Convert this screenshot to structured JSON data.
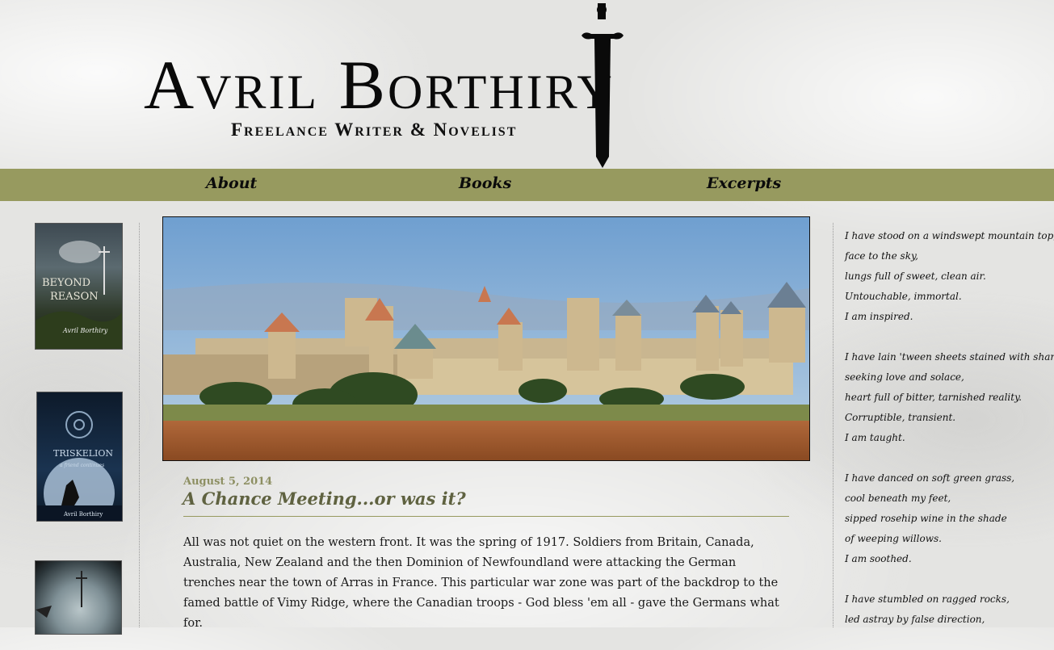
{
  "header": {
    "author_name": "Avril Borthiry",
    "tagline": "Freelance Writer & Novelist"
  },
  "nav": {
    "items": [
      "About",
      "Books",
      "Excerpts"
    ],
    "color": "#979a5f"
  },
  "covers": [
    {
      "title_line1": "BEYOND",
      "title_line2": "REASON",
      "author": "Avril Borthiry"
    },
    {
      "title": "TRISKELION",
      "subtitle": "a friend continues",
      "author": "Avril Borthiry"
    },
    {}
  ],
  "post": {
    "date": "August 5, 2014",
    "title": "A Chance Meeting...or was it?",
    "body": "All was not quiet on the western front. It was the spring of 1917. Soldiers from Britain, Canada, Australia, New Zealand and the then Dominion of Newfoundland were attacking the German trenches near the town of Arras in France. This particular war zone was part of the backdrop to the famed battle of Vimy Ridge, where the Canadian troops - God bless 'em all - gave the Germans what for."
  },
  "poem": {
    "stanzas": [
      [
        "I have stood on a windswept mountain top,",
        "face to the sky,",
        "lungs full of sweet, clean air.",
        "Untouchable, immortal.",
        "I am inspired."
      ],
      [
        "I have lain 'tween sheets stained with shame,",
        "seeking love and solace,",
        "heart full of bitter, tarnished reality.",
        "Corruptible, transient.",
        "I am taught."
      ],
      [
        "I have danced on soft green grass,",
        "cool beneath my feet,",
        "sipped rosehip wine in the shade",
        "of weeping willows.",
        "I am soothed."
      ],
      [
        "I have stumbled on ragged rocks,",
        "led astray by false direction,"
      ]
    ]
  }
}
